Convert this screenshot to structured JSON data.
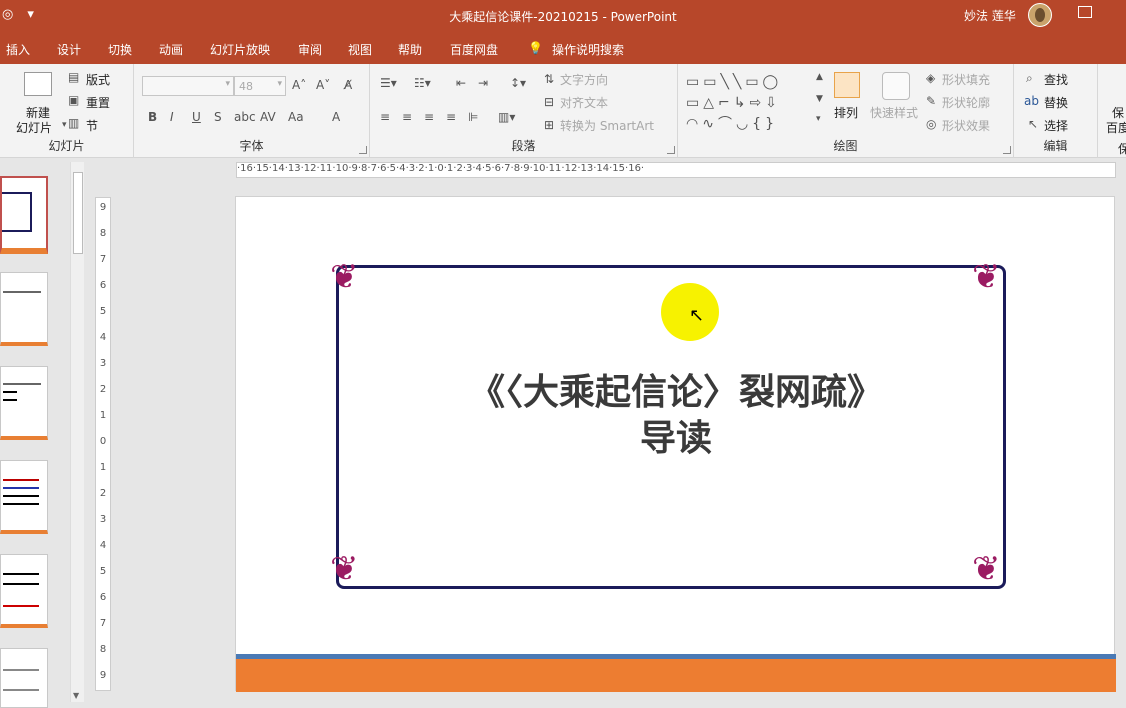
{
  "titlebar": {
    "title": "大乘起信论课件-20210215  -  PowerPoint",
    "user": "妙法 莲华"
  },
  "tabs": [
    "插入",
    "设计",
    "切换",
    "动画",
    "幻灯片放映",
    "审阅",
    "视图",
    "帮助",
    "百度网盘",
    "操作说明搜索"
  ],
  "ribbon": {
    "slides": {
      "new_slide_line1": "新建",
      "new_slide_line2": "幻灯片",
      "layout": "版式",
      "reset": "重置",
      "section": "节",
      "label": "幻灯片"
    },
    "font": {
      "font_size": "48",
      "label": "字体"
    },
    "paragraph": {
      "text_direction": "文字方向",
      "align_text": "对齐文本",
      "convert_smartart": "转换为 SmartArt",
      "label": "段落"
    },
    "drawing": {
      "arrange": "排列",
      "quick_styles": "快速样式",
      "shape_fill": "形状填充",
      "shape_outline": "形状轮廓",
      "shape_effects": "形状效果",
      "label": "绘图"
    },
    "editing": {
      "find": "查找",
      "replace": "替换",
      "select": "选择",
      "label": "编辑"
    },
    "extra": {
      "save_line1": "保",
      "save_line2": "百度",
      "label": "保"
    }
  },
  "ruler_h": "·16·15·14·13·12·11·10·9·8·7·6·5·4·3·2·1·0·1·2·3·4·5·6·7·8·9·10·11·12·13·14·15·16·",
  "ruler_v": [
    "9",
    "8",
    "7",
    "6",
    "5",
    "4",
    "3",
    "2",
    "1",
    "0",
    "1",
    "2",
    "3",
    "4",
    "5",
    "6",
    "7",
    "8",
    "9"
  ],
  "slide": {
    "title_line1": "《〈大乘起信论〉裂网疏》",
    "title_line2": "导读"
  },
  "colors": {
    "accent": "#b7472a",
    "frame": "#1b1b5a",
    "ornament": "#9b1b62",
    "bar_blue": "#4a7ab5",
    "bar_orange": "#ed7d31",
    "cursor_highlight": "#f7f200"
  }
}
